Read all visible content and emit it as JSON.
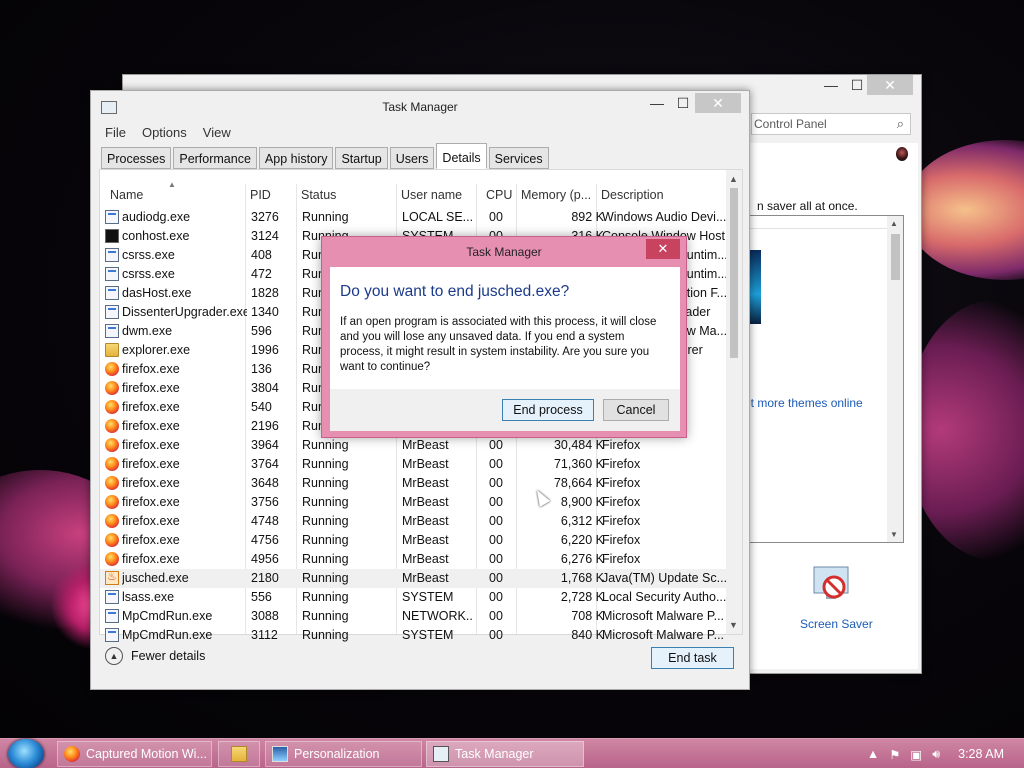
{
  "personalization": {
    "search_placeholder": "Control Panel",
    "intro_text": "n saver all at once.",
    "more_themes_link": "et more themes online",
    "screen_saver_label": "Screen Saver"
  },
  "task_manager": {
    "title": "Task Manager",
    "menu": [
      "File",
      "Options",
      "View"
    ],
    "tabs": [
      {
        "label": "Processes",
        "active": false
      },
      {
        "label": "Performance",
        "active": false
      },
      {
        "label": "App history",
        "active": false
      },
      {
        "label": "Startup",
        "active": false
      },
      {
        "label": "Users",
        "active": false
      },
      {
        "label": "Details",
        "active": true
      },
      {
        "label": "Services",
        "active": false
      }
    ],
    "columns": [
      "Name",
      "PID",
      "Status",
      "User name",
      "CPU",
      "Memory (p...",
      "Description"
    ],
    "rows": [
      {
        "name": "audiodg.exe",
        "pid": "3276",
        "status": "Running",
        "user": "LOCAL SE...",
        "cpu": "00",
        "mem": "892 K",
        "desc": "Windows Audio Devi...",
        "icon": "window"
      },
      {
        "name": "conhost.exe",
        "pid": "3124",
        "status": "Running",
        "user": "SYSTEM",
        "cpu": "00",
        "mem": "316 K",
        "desc": "Console Window Host",
        "icon": "console"
      },
      {
        "name": "csrss.exe",
        "pid": "408",
        "status": "Running",
        "user": "",
        "cpu": "",
        "mem": "",
        "desc": "Client Server Runtim...",
        "icon": "window"
      },
      {
        "name": "csrss.exe",
        "pid": "472",
        "status": "Running",
        "user": "",
        "cpu": "",
        "mem": "",
        "desc": "Client Server Runtim...",
        "icon": "window"
      },
      {
        "name": "dasHost.exe",
        "pid": "1828",
        "status": "Running",
        "user": "",
        "cpu": "",
        "mem": "",
        "desc": "Device Association F...",
        "icon": "window"
      },
      {
        "name": "DissenterUpgrader.exe",
        "pid": "1340",
        "status": "Running",
        "user": "",
        "cpu": "",
        "mem": "",
        "desc": "Dissenter Upgrader",
        "icon": "window"
      },
      {
        "name": "dwm.exe",
        "pid": "596",
        "status": "Running",
        "user": "",
        "cpu": "",
        "mem": "",
        "desc": "Desktop Window Ma...",
        "icon": "window"
      },
      {
        "name": "explorer.exe",
        "pid": "1996",
        "status": "Running",
        "user": "",
        "cpu": "",
        "mem": "",
        "desc": "Windows Explorer",
        "icon": "folder"
      },
      {
        "name": "firefox.exe",
        "pid": "136",
        "status": "Running",
        "user": "",
        "cpu": "",
        "mem": "",
        "desc": "",
        "icon": "firefox"
      },
      {
        "name": "firefox.exe",
        "pid": "3804",
        "status": "Running",
        "user": "",
        "cpu": "",
        "mem": "",
        "desc": "",
        "icon": "firefox"
      },
      {
        "name": "firefox.exe",
        "pid": "540",
        "status": "Running",
        "user": "",
        "cpu": "",
        "mem": "",
        "desc": "",
        "icon": "firefox"
      },
      {
        "name": "firefox.exe",
        "pid": "2196",
        "status": "Running",
        "user": "",
        "cpu": "",
        "mem": "",
        "desc": "",
        "icon": "firefox"
      },
      {
        "name": "firefox.exe",
        "pid": "3964",
        "status": "Running",
        "user": "MrBeast",
        "cpu": "00",
        "mem": "30,484 K",
        "desc": "Firefox",
        "icon": "firefox"
      },
      {
        "name": "firefox.exe",
        "pid": "3764",
        "status": "Running",
        "user": "MrBeast",
        "cpu": "00",
        "mem": "71,360 K",
        "desc": "Firefox",
        "icon": "firefox"
      },
      {
        "name": "firefox.exe",
        "pid": "3648",
        "status": "Running",
        "user": "MrBeast",
        "cpu": "00",
        "mem": "78,664 K",
        "desc": "Firefox",
        "icon": "firefox"
      },
      {
        "name": "firefox.exe",
        "pid": "3756",
        "status": "Running",
        "user": "MrBeast",
        "cpu": "00",
        "mem": "8,900 K",
        "desc": "Firefox",
        "icon": "firefox"
      },
      {
        "name": "firefox.exe",
        "pid": "4748",
        "status": "Running",
        "user": "MrBeast",
        "cpu": "00",
        "mem": "6,312 K",
        "desc": "Firefox",
        "icon": "firefox"
      },
      {
        "name": "firefox.exe",
        "pid": "4756",
        "status": "Running",
        "user": "MrBeast",
        "cpu": "00",
        "mem": "6,220 K",
        "desc": "Firefox",
        "icon": "firefox"
      },
      {
        "name": "firefox.exe",
        "pid": "4956",
        "status": "Running",
        "user": "MrBeast",
        "cpu": "00",
        "mem": "6,276 K",
        "desc": "Firefox",
        "icon": "firefox"
      },
      {
        "name": "jusched.exe",
        "pid": "2180",
        "status": "Running",
        "user": "MrBeast",
        "cpu": "00",
        "mem": "1,768 K",
        "desc": "Java(TM) Update Sc...",
        "icon": "java",
        "selected": true
      },
      {
        "name": "lsass.exe",
        "pid": "556",
        "status": "Running",
        "user": "SYSTEM",
        "cpu": "00",
        "mem": "2,728 K",
        "desc": "Local Security Autho...",
        "icon": "window"
      },
      {
        "name": "MpCmdRun.exe",
        "pid": "3088",
        "status": "Running",
        "user": "NETWORK...",
        "cpu": "00",
        "mem": "708 K",
        "desc": "Microsoft Malware P...",
        "icon": "window"
      },
      {
        "name": "MpCmdRun.exe",
        "pid": "3112",
        "status": "Running",
        "user": "SYSTEM",
        "cpu": "00",
        "mem": "840 K",
        "desc": "Microsoft Malware P...",
        "icon": "window"
      }
    ],
    "fewer_details": "Fewer details",
    "end_task": "End task"
  },
  "dialog": {
    "title": "Task Manager",
    "heading": "Do you want to end jusched.exe?",
    "message": "If an open program is associated with this process, it will close and you will lose any unsaved data. If you end a system process, it might result in system instability. Are you sure you want to continue?",
    "end_process": "End process",
    "cancel": "Cancel"
  },
  "taskbar": {
    "firefox_label": "Captured Motion Wi...",
    "personalization_label": "Personalization",
    "taskmanager_label": "Task Manager",
    "clock": "3:28 AM"
  },
  "colors": {
    "taskbar": "#c17497",
    "dialog_frame": "#e78fb1",
    "link": "#1c5bb8",
    "dialog_heading": "#1b3a8a"
  }
}
